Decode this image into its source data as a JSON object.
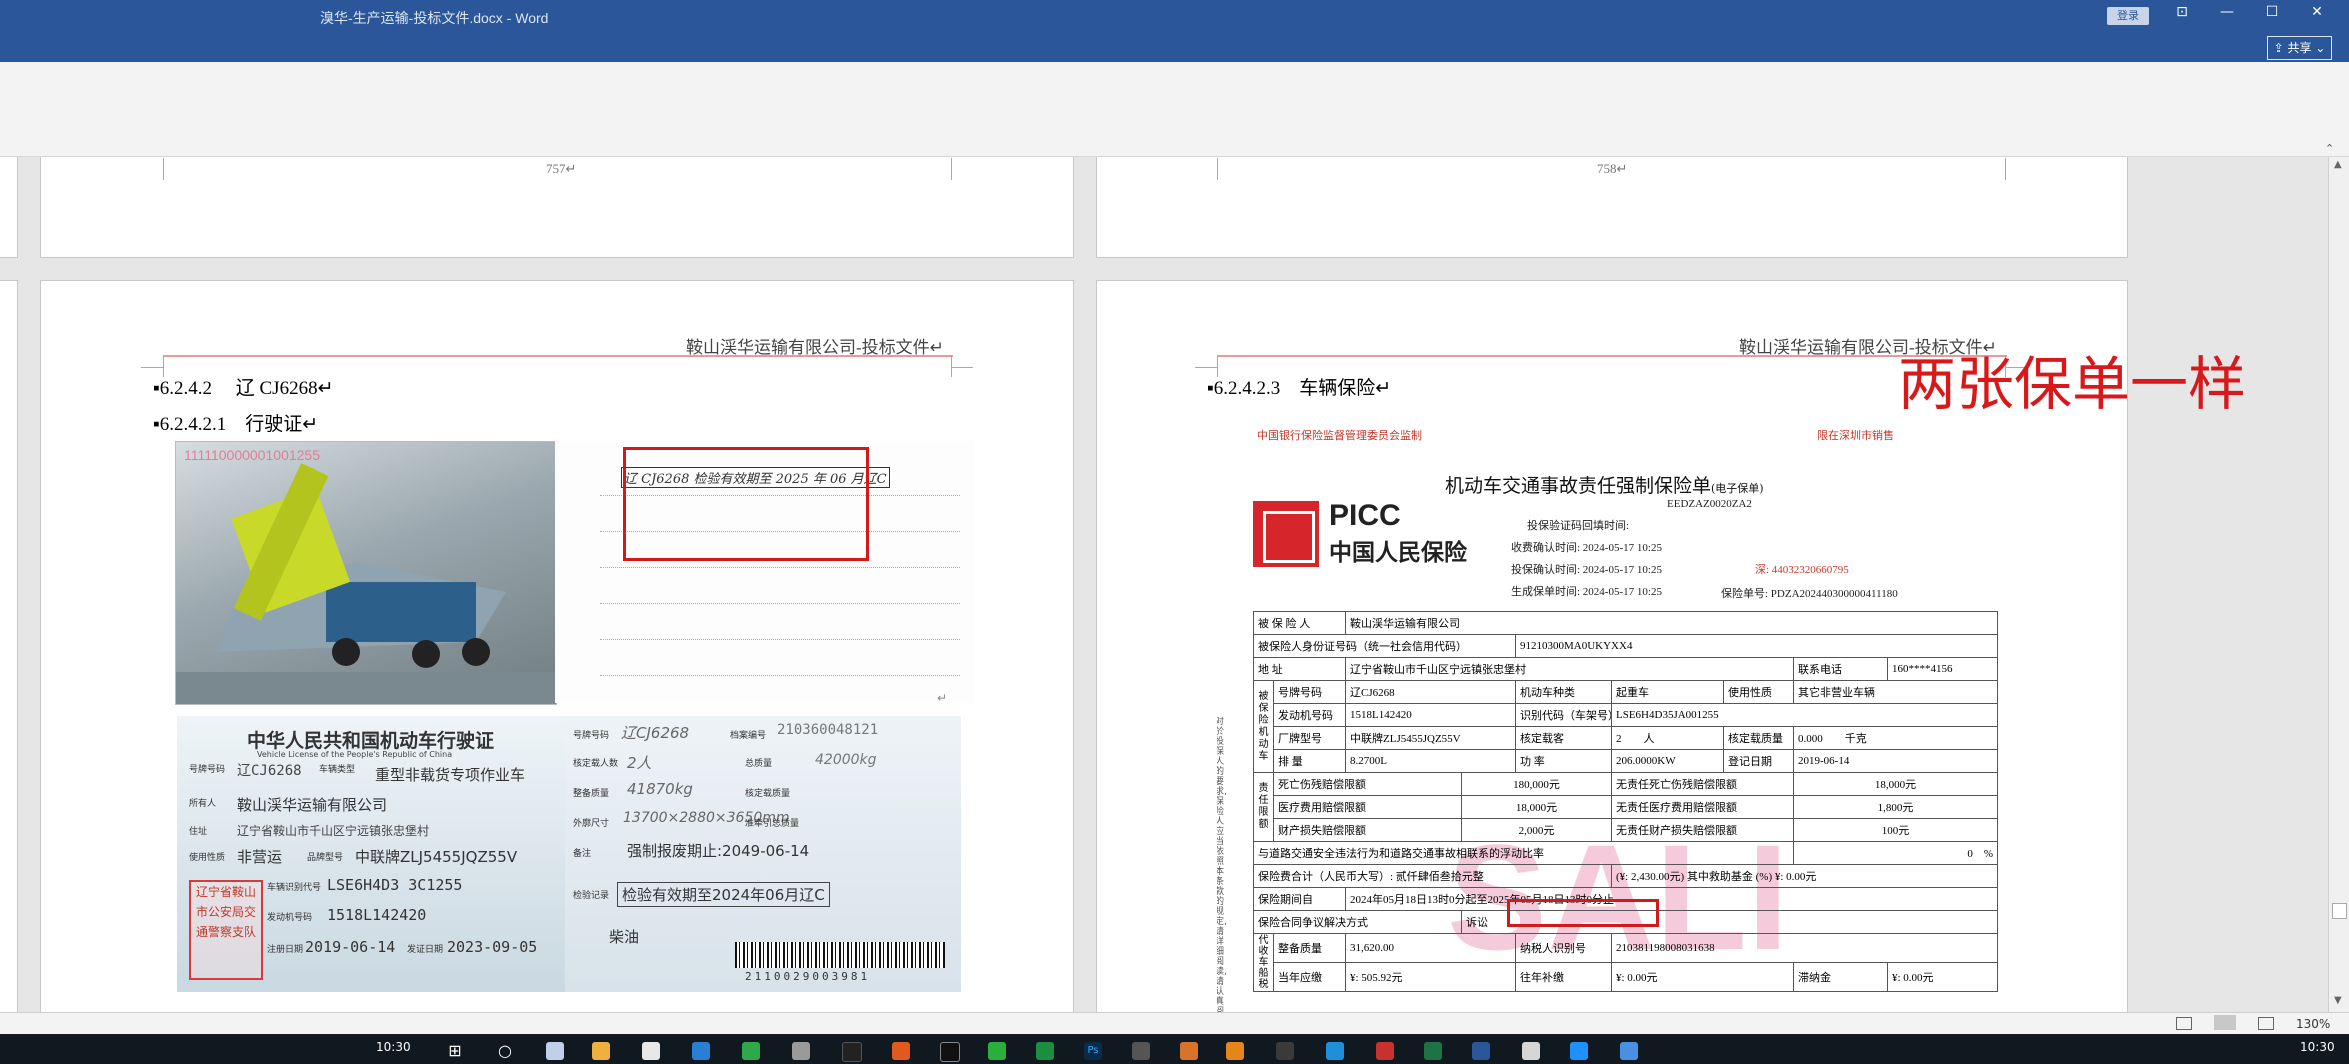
{
  "window": {
    "title": "溴华-生产运输-投标文件.docx  -  Word",
    "login_label": "登录",
    "share_label": "共享",
    "controls": [
      "restore-ribbon-icon",
      "minimize-icon",
      "maximize-icon",
      "close-icon"
    ]
  },
  "pages": {
    "top_left_number": "757↵",
    "top_right_number": "758↵",
    "left": {
      "header": "鞍山渓华运输有限公司-投标文件↵",
      "heading1": "6.2.4.2　 辽 CJ6268↵",
      "heading2": "6.2.4.2.1　行驶证↵",
      "photo1_watermark": "111110000001001255",
      "handwritten_note": "辽 CJ6268 检验有效期至 2025 年 06 月辽C",
      "license": {
        "title": "中华人民共和国机动车行驶证",
        "title_en": "Vehicle License of the People's Republic of China",
        "plate": "辽CJ6268",
        "vehicle_type": "重型非载货专项作业车",
        "owner": "鞍山渓华运输有限公司",
        "address": "辽宁省鞍山市千山区宁远镇张忠堡村",
        "use_nature": "非营运",
        "model": "中联牌ZLJ5455JQZ55V",
        "vin": "LSE6H4D3 3C1255",
        "engine": "1518L142420",
        "register_date": "2019-06-14",
        "issue_date": "2023-09-05",
        "seal": "辽宁省鞍山市公安局交通警察支队",
        "record_no": "210360048121",
        "passengers": "2人",
        "total_mass": "42000kg",
        "curb_mass": "41870kg",
        "dimensions": "13700×2880×3650mm",
        "scrap_date": "强制报废期止:2049-06-14",
        "inspection": "检验有效期至2024年06月辽C",
        "fuel": "柴油",
        "barcode": "2110029003981"
      }
    },
    "right": {
      "header": "鞍山渓华运输有限公司-投标文件↵",
      "heading": "6.2.4.2.3　车辆保险↵",
      "annotation": "两张保单一样",
      "watermark": "SALI",
      "policy": {
        "top_left_red": "中国银行保险监督管理委员会监制",
        "top_right_red": "限在深圳市销售",
        "title": "机动车交通事故责任强制保险单",
        "title_suffix": "(电子保单)",
        "code": "EEDZAZ0020ZA2",
        "logo_en": "PICC",
        "logo_cn": "中国人民保险",
        "verify_code_label": "投保验证码回填时间:",
        "lines": [
          "收费确认时间: 2024-05-17 10:25",
          "投保确认时间: 2024-05-17 10:25",
          "生成保单时间: 2024-05-17 10:25"
        ],
        "red_no": "深: 44032320660795",
        "policy_no": "保险单号: PDZA202440300000411180",
        "side_text": "对於投保人的要求,保险人应当依照本条款的规定,请详细阅读,请认真阅读本保险条款...",
        "rows": [
          [
            "被 保 险 人",
            "鞍山渓华运输有限公司"
          ],
          [
            "被保险人身份证号码（统一社会信用代码）",
            "91210300MA0UKYXX4"
          ],
          [
            "地 址",
            "辽宁省鞍山市千山区宁远镇张忠堡村",
            "联系电话",
            "160****4156"
          ]
        ],
        "vehicle_rows": [
          [
            "号牌号码",
            "辽CJ6268",
            "机动车种类",
            "起重车",
            "使用性质",
            "其它非营业车辆"
          ],
          [
            "发动机号码",
            "1518L142420",
            "识别代码（车架号）",
            "LSE6H4D35JA001255",
            "",
            ""
          ],
          [
            "厂牌型号",
            "中联牌ZLJ5455JQZ55V",
            "核定载客",
            "2　　人",
            "核定载质量",
            "0.000　　千克"
          ],
          [
            "排 量",
            "8.2700L",
            "功 率",
            "206.0000KW",
            "登记日期",
            "2019-06-14"
          ]
        ],
        "liability_rows": [
          [
            "死亡伤残赔偿限额",
            "180,000元",
            "无责任死亡伤残赔偿限额",
            "18,000元"
          ],
          [
            "医疗费用赔偿限额",
            "18,000元",
            "无责任医疗费用赔偿限额",
            "1,800元"
          ],
          [
            "财产损失赔偿限额",
            "2,000元",
            "无责任财产损失赔偿限额",
            "100元"
          ]
        ],
        "float_rate": "与道路交通安全违法行为和道路交通事故相联系的浮动比率",
        "float_value": "0　%",
        "premium": "保险费合计（人民币大写）: 贰仟肆佰叁拾元整",
        "premium_value": "(¥: 2,430.00元) 其中救助基金 (%) ¥: 0.00元",
        "period_label": "保险期间自",
        "period_value": "2024年05月18日13时0分起至2025年05月18日13时0分止",
        "dispute_label": "保险合同争议解决方式",
        "dispute_value": "诉讼",
        "tax_rows": [
          [
            "整备质量",
            "31,620.00",
            "纳税人识别号",
            "210381198008031638"
          ],
          [
            "当年应缴",
            "¥: 505.92元",
            "往年补缴",
            "¥: 0.00元",
            "滞纳金",
            "¥: 0.00元"
          ]
        ],
        "tax_label": "代收车船税"
      }
    }
  },
  "status": {
    "zoom": "130%"
  },
  "taskbar": {
    "time": "10:30",
    "time_right": "10:30"
  }
}
